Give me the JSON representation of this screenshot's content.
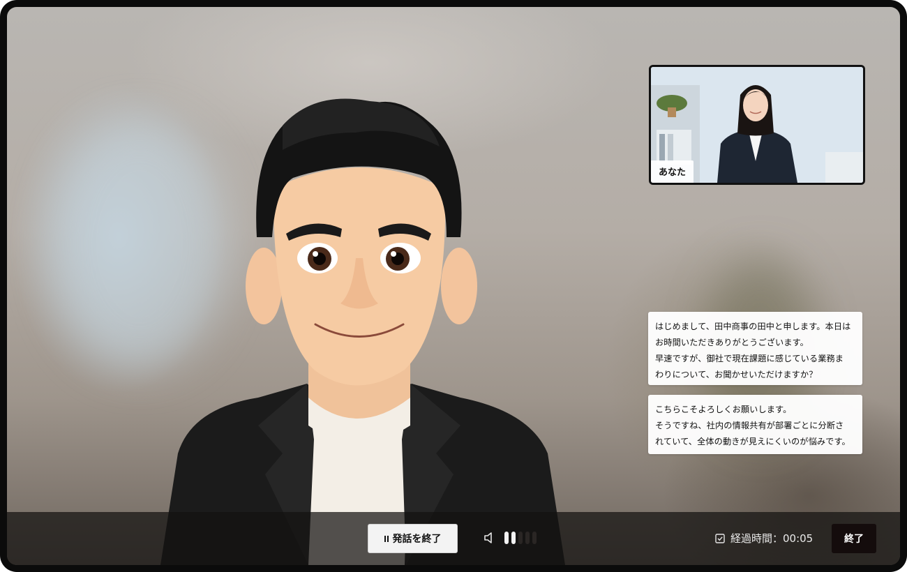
{
  "self_view": {
    "label": "あなた"
  },
  "chat": {
    "messages": [
      {
        "lines": [
          "はじめまして、田中商事の田中と申します。本日は",
          "お時間いただきありがとうございます。",
          "早速ですが、御社で現在課題に感じている業務ま",
          "わりについて、お聞かせいただけますか？"
        ]
      },
      {
        "lines": [
          "こちらこそよろしくお願いします。",
          "そうですね、社内の情報共有が部署ごとに分断さ",
          "れていて、全体の動きが見えにくいのが悩みです。"
        ]
      }
    ]
  },
  "controls": {
    "end_speech_label": "発話を終了",
    "elapsed_label": "経過時間：00:05",
    "finish_label": "終了",
    "audio_level_active_bars": 2,
    "audio_level_total_bars": 5
  },
  "colors": {
    "bar_bg": "#141210",
    "button_dark": "#140c0c",
    "bubble_bg": "#ffffff"
  },
  "icons": [
    "pause-icon",
    "speaker-icon",
    "checkbox-icon"
  ]
}
